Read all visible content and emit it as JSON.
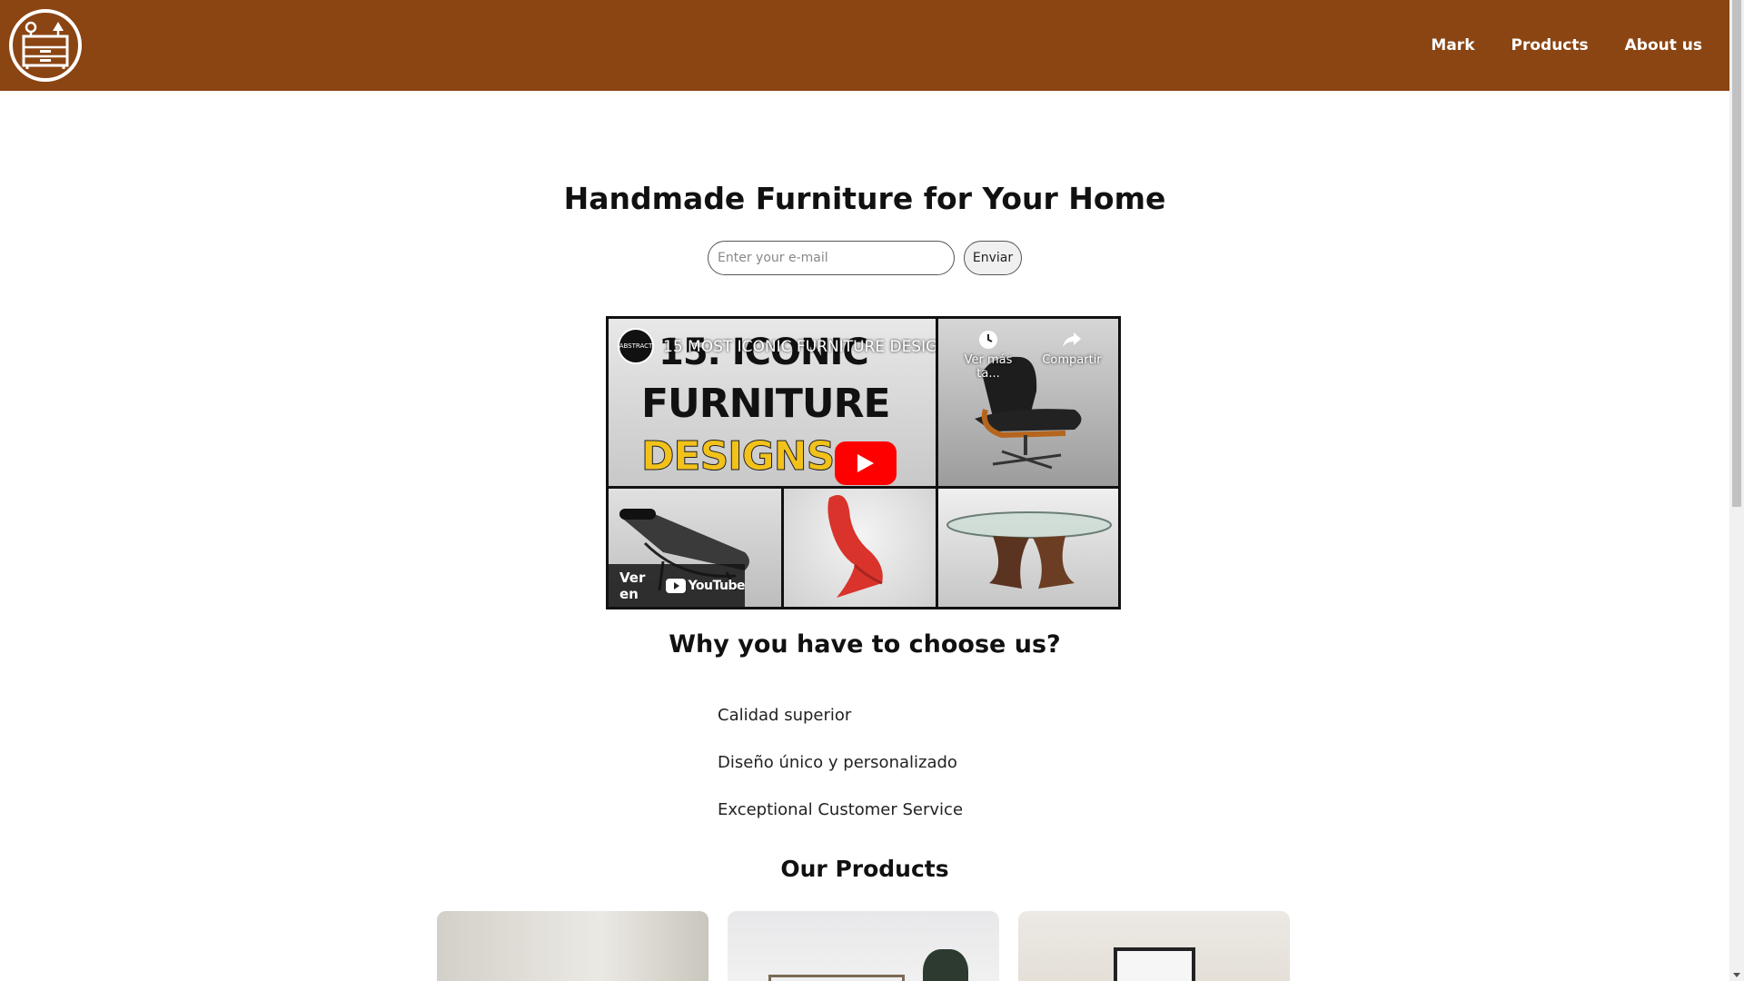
{
  "header": {
    "logo_label": "furniture-logo",
    "nav": [
      {
        "label": "Mark"
      },
      {
        "label": "Products"
      },
      {
        "label": "About us"
      }
    ],
    "background_color": "#8b4513"
  },
  "hero": {
    "title": "Handmade Furniture for Your Home",
    "email_placeholder": "Enter your e-mail",
    "send_label": "Enviar"
  },
  "video": {
    "title": "15 MOST ICONIC FURNITURE DESIG...",
    "channel": "ABSTRACT",
    "thumb_line1": "15. ICONIC",
    "thumb_line2": "FURNITURE",
    "thumb_line3": "DESIGNS",
    "watch_later": "Ver más ta...",
    "share": "Compartir",
    "watch_on": "Ver en",
    "platform": "YouTube"
  },
  "why": {
    "title": "Why you have to choose us?",
    "features": [
      "Calidad superior",
      "Diseño único y personalizado",
      "Exceptional Customer Service"
    ]
  },
  "products": {
    "title": "Our Products"
  }
}
